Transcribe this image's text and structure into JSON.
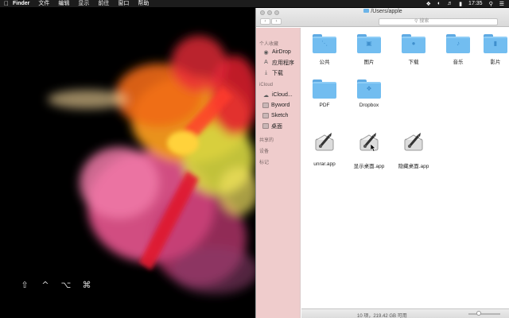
{
  "menubar": {
    "app": "Finder",
    "items": [
      "文件",
      "编辑",
      "显示",
      "前往",
      "窗口",
      "帮助"
    ],
    "clock": "17:35"
  },
  "keys": [
    "⇧",
    "^",
    "⌥",
    "⌘"
  ],
  "window": {
    "title": "/Users/apple",
    "search_placeholder": "搜索"
  },
  "sidebar": {
    "favorites_header": "个人收藏",
    "favorites": [
      "AirDrop",
      "应用程序",
      "下载"
    ],
    "icloud_header": "iCloud",
    "icloud": [
      "iCloud...",
      "Byword",
      "Sketch",
      "桌面"
    ],
    "shared_header": "共享的",
    "devices_header": "设备",
    "tags_header": "标记"
  },
  "content": {
    "folders": [
      {
        "label": "公共",
        "icon": "public-folder-icon"
      },
      {
        "label": "图片",
        "icon": "pictures-folder-icon"
      },
      {
        "label": "下载",
        "icon": "downloads-folder-icon"
      },
      {
        "label": "音乐",
        "icon": "music-folder-icon"
      },
      {
        "label": "影片",
        "icon": "movies-folder-icon"
      },
      {
        "label": "PDF",
        "icon": "folder-icon"
      },
      {
        "label": "Dropbox",
        "icon": "dropbox-folder-icon"
      }
    ],
    "apps": [
      {
        "label": "unrar.app",
        "icon": "applescript-app-icon"
      },
      {
        "label": "显示桌面.app",
        "icon": "applescript-app-icon"
      },
      {
        "label": "隐藏桌面.app",
        "icon": "applescript-app-icon"
      }
    ]
  },
  "status": {
    "text": "10 项，219.42 GB 可用"
  }
}
